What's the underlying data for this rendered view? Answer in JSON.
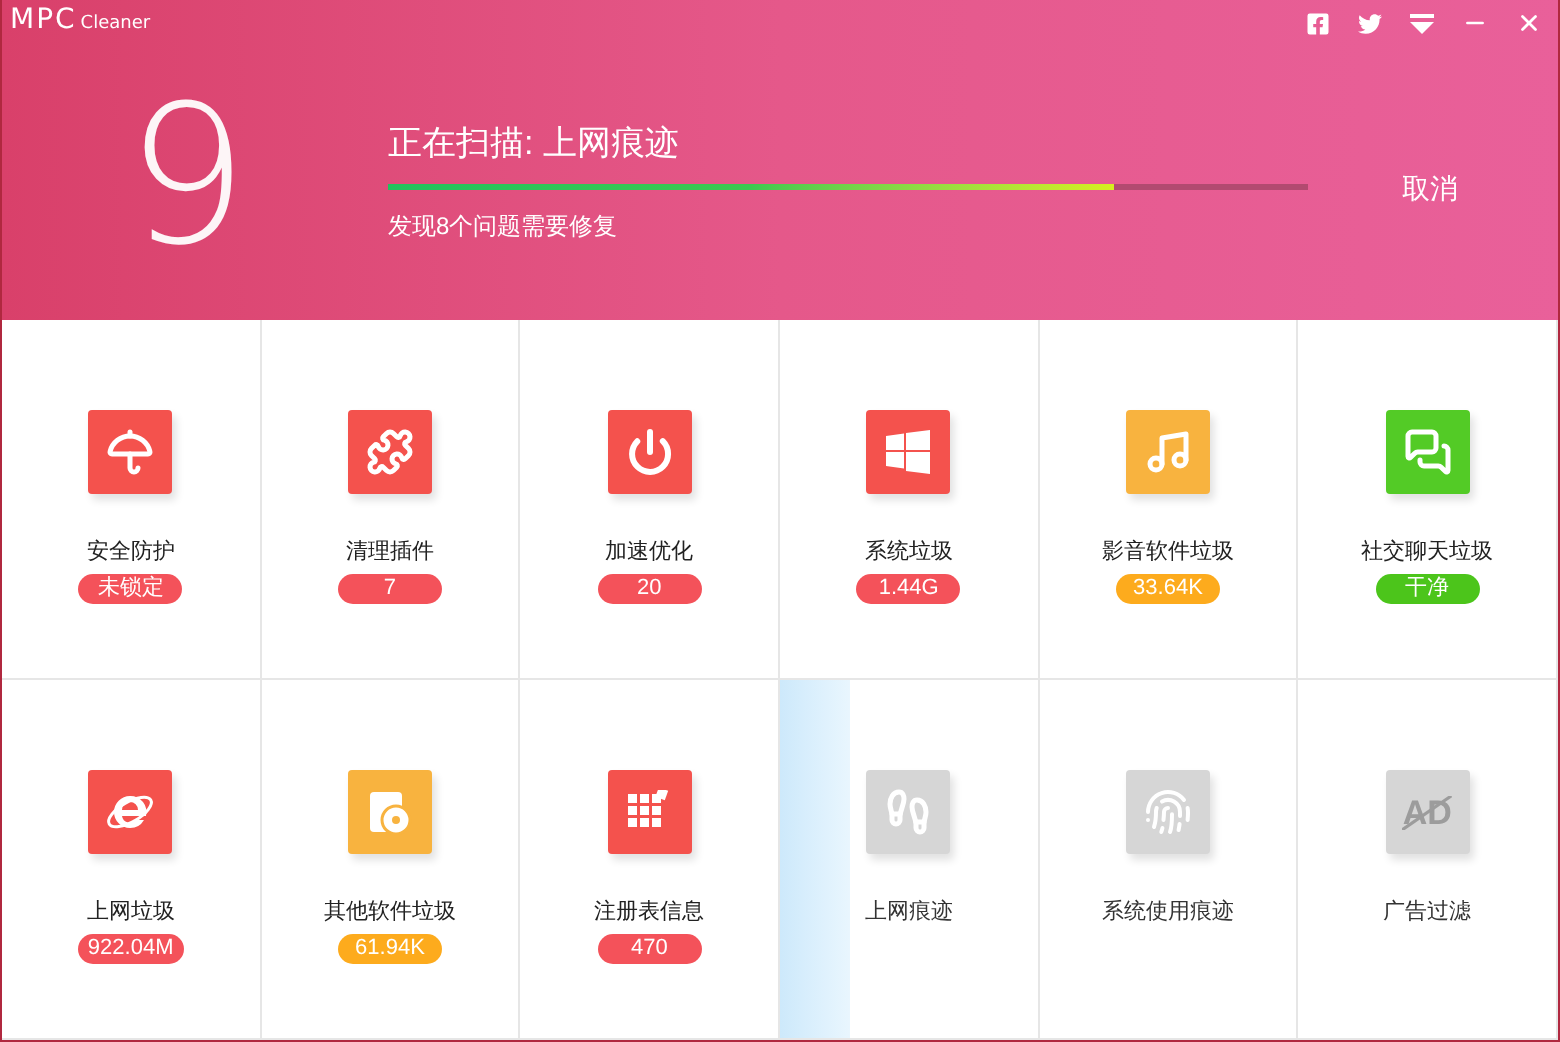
{
  "app": {
    "logo": "MPC",
    "name": "Cleaner"
  },
  "scan": {
    "count": "9",
    "title": "正在扫描: 上网痕迹",
    "level": 0.79,
    "subtitle": "发现8个问题需要修复",
    "cancel": "取消"
  },
  "items": [
    {
      "label": "安全防护",
      "kind": "done",
      "color": "#f4524d",
      "badge": {
        "text": "未锁定",
        "color": "#f4525a"
      }
    },
    {
      "label": "清理插件",
      "kind": "done",
      "color": "#f4524d",
      "badge": {
        "text": "7",
        "color": "#f4525a"
      }
    },
    {
      "label": "加速优化",
      "kind": "done",
      "color": "#f4524d",
      "badge": {
        "text": "20",
        "color": "#f4525a"
      }
    },
    {
      "label": "系统垃圾",
      "kind": "done",
      "color": "#f4524d",
      "badge": {
        "text": "1.44G",
        "color": "#f4525a"
      }
    },
    {
      "label": "影音软件垃圾",
      "kind": "done",
      "color": "#f8b33f",
      "badge": {
        "text": "33.64K",
        "color": "#fdab1d"
      }
    },
    {
      "label": "社交聊天垃圾",
      "kind": "done",
      "color": "#53cb26",
      "badge": {
        "text": "干净",
        "color": "#4cc51b"
      }
    },
    {
      "label": "上网垃圾",
      "kind": "done",
      "color": "#f4524d",
      "badge": {
        "text": "922.04M",
        "color": "#f4525a"
      }
    },
    {
      "label": "其他软件垃圾",
      "kind": "done",
      "color": "#f8b33f",
      "badge": {
        "text": "61.94K",
        "color": "#fdab1d"
      }
    },
    {
      "label": "注册表信息",
      "kind": "done",
      "color": "#f4524d",
      "badge": {
        "text": "470",
        "color": "#f4525a"
      }
    },
    {
      "label": "上网痕迹",
      "kind": "scanning",
      "color": "#d6d6d6"
    },
    {
      "label": "系统使用痕迹",
      "kind": "pending",
      "color": "#d6d6d6"
    },
    {
      "label": "广告过滤",
      "icon_text": "AD",
      "kind": "pending",
      "color": "#d6d6d6"
    }
  ]
}
